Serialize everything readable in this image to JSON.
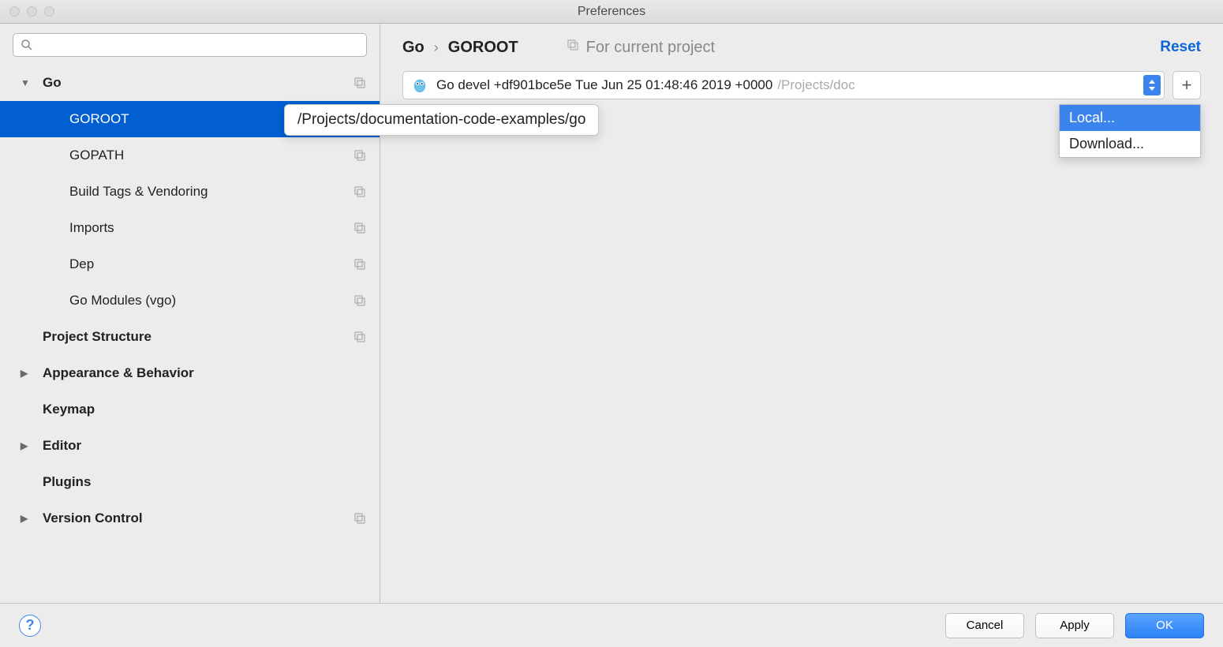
{
  "window": {
    "title": "Preferences"
  },
  "sidebar": {
    "search_placeholder": "",
    "items": [
      {
        "label": "Go",
        "type": "root",
        "expanded": true,
        "copyable": true
      },
      {
        "label": "GOROOT",
        "type": "child",
        "selected": true
      },
      {
        "label": "GOPATH",
        "type": "child",
        "copyable": true
      },
      {
        "label": "Build Tags & Vendoring",
        "type": "child",
        "copyable": true
      },
      {
        "label": "Imports",
        "type": "child",
        "copyable": true
      },
      {
        "label": "Dep",
        "type": "child",
        "copyable": true
      },
      {
        "label": "Go Modules (vgo)",
        "type": "child",
        "copyable": true
      },
      {
        "label": "Project Structure",
        "type": "root",
        "copyable": true
      },
      {
        "label": "Appearance & Behavior",
        "type": "root",
        "expandable": true
      },
      {
        "label": "Keymap",
        "type": "root"
      },
      {
        "label": "Editor",
        "type": "root",
        "expandable": true
      },
      {
        "label": "Plugins",
        "type": "root"
      },
      {
        "label": "Version Control",
        "type": "root",
        "expandable": true,
        "copyable": true
      }
    ]
  },
  "header": {
    "breadcrumb": [
      "Go",
      "GOROOT"
    ],
    "scope_label": "For current project",
    "reset_label": "Reset"
  },
  "sdk": {
    "main_text": "Go devel +df901bce5e Tue Jun 25 01:48:46 2019 +0000",
    "path_text": "/Projects/doc",
    "tooltip": "/Projects/documentation-code-examples/go",
    "add_label": "+"
  },
  "dropdown": {
    "items": [
      {
        "label": "Local...",
        "highlighted": true
      },
      {
        "label": "Download...",
        "highlighted": false
      }
    ]
  },
  "footer": {
    "help_label": "?",
    "cancel_label": "Cancel",
    "apply_label": "Apply",
    "ok_label": "OK"
  }
}
